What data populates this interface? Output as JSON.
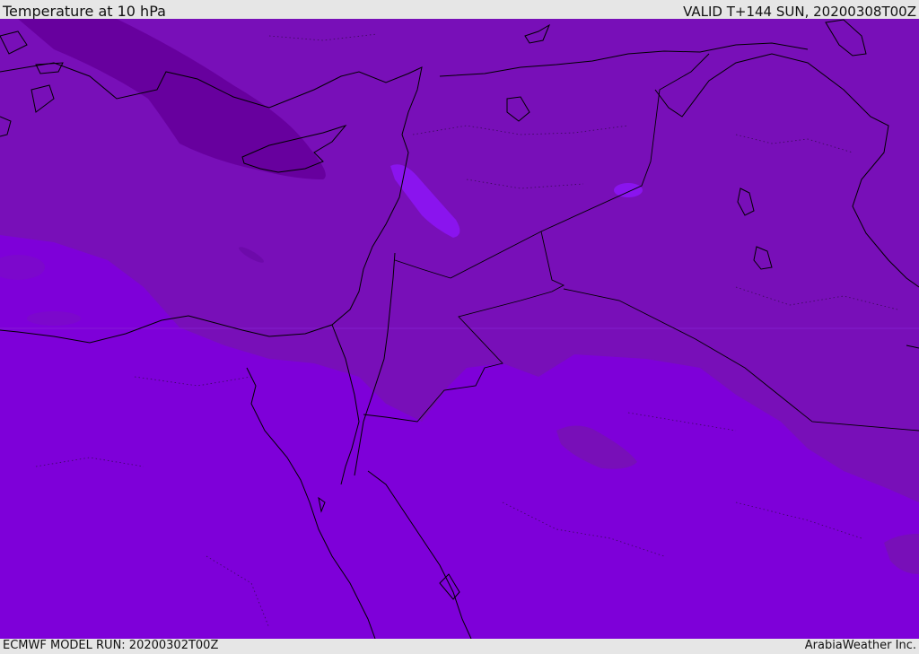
{
  "header": {
    "title": "Temperature at 10 hPa",
    "valid": "VALID T+144 SUN, 20200308T00Z"
  },
  "footer": {
    "model_run": "ECMWF MODEL RUN: 20200302T00Z",
    "credit": "ArabiaWeather Inc."
  },
  "colors": {
    "coldest": "#67009e",
    "cold": "#780fb8",
    "mid": "#7c08cc",
    "warm": "#7e00d9",
    "warmest": "#8a14ee",
    "coast": "#000000"
  }
}
